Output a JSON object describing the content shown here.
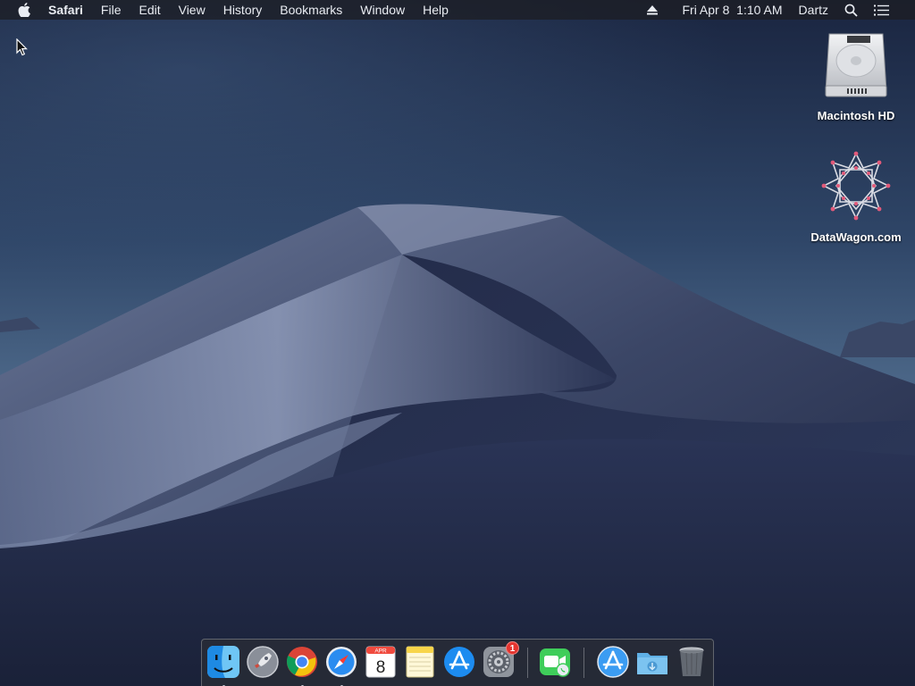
{
  "menubar": {
    "app_name": "Safari",
    "menus": [
      "File",
      "Edit",
      "View",
      "History",
      "Bookmarks",
      "Window",
      "Help"
    ],
    "clock": "Fri Apr 8  1:10 AM",
    "user": "Dartz"
  },
  "desktop": {
    "icons": [
      {
        "label": "Macintosh HD",
        "icon": "hard-drive-icon"
      },
      {
        "label": "DataWagon.com",
        "icon": "network-volume-icon"
      }
    ]
  },
  "dock": {
    "items": [
      {
        "name": "Finder",
        "icon": "finder-icon",
        "running": true
      },
      {
        "name": "Launchpad",
        "icon": "launchpad-icon",
        "running": false
      },
      {
        "name": "Google Chrome",
        "icon": "chrome-icon",
        "running": true
      },
      {
        "name": "Safari",
        "icon": "safari-icon",
        "running": true
      },
      {
        "name": "Calendar",
        "icon": "calendar-icon",
        "running": false,
        "month": "APR",
        "day": "8"
      },
      {
        "name": "Notes",
        "icon": "notes-icon",
        "running": false
      },
      {
        "name": "App Store",
        "icon": "app-store-icon",
        "running": false
      },
      {
        "name": "System Preferences",
        "icon": "system-preferences-icon",
        "running": false,
        "badge": "1"
      },
      {
        "name": "FaceTime",
        "icon": "facetime-icon",
        "running": false
      },
      {
        "name": "Applications",
        "icon": "applications-folder-icon",
        "running": false
      },
      {
        "name": "Downloads",
        "icon": "downloads-folder-icon",
        "running": false
      },
      {
        "name": "Trash",
        "icon": "trash-icon",
        "running": false
      }
    ]
  },
  "colors": {
    "menubar_bg": "#1c1e24",
    "sky_top": "#1e2b47",
    "sky_mid": "#3c5678",
    "dune_light": "#8b97b5",
    "dune_dark": "#1d2540",
    "badge": "#e5342f"
  }
}
